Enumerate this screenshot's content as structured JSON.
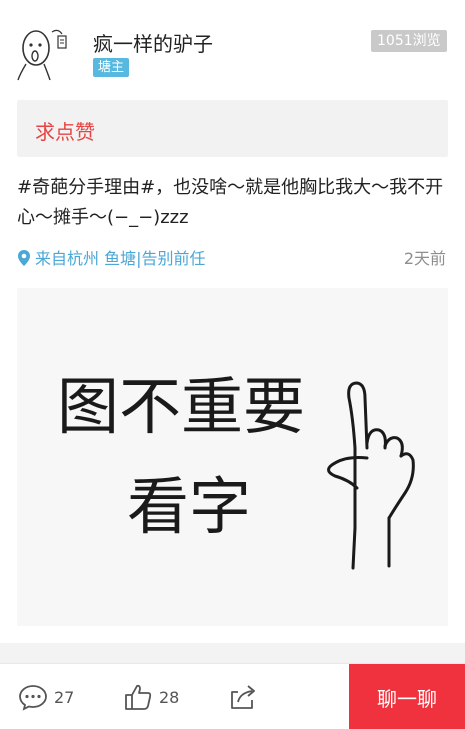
{
  "user": {
    "name": "疯一样的驴子",
    "badge": "塘主",
    "views": "1051浏览"
  },
  "like_banner": "求点赞",
  "post": {
    "text": "#奇葩分手理由#，也没啥～就是他胸比我大～我不开心～摊手～(−_−)zzz",
    "location": "来自杭州 鱼塘|告别前任",
    "time": "2天前",
    "image_text_line1": "图不重要",
    "image_text_line2": "看字"
  },
  "bottom_bar": {
    "comment_count": "27",
    "like_count": "28",
    "chat_label": "聊一聊"
  },
  "colors": {
    "accent_red": "#f0323e",
    "link_blue": "#4aa7d6",
    "badge_blue": "#57b9e0"
  }
}
